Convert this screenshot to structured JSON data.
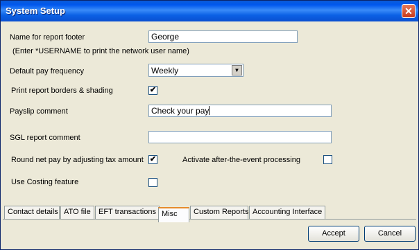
{
  "window": {
    "title": "System Setup"
  },
  "form": {
    "footer_label": "Name for report footer",
    "footer_value": "George",
    "footer_hint": "(Enter *USERNAME to print the network user name)",
    "pay_freq_label": "Default pay frequency",
    "pay_freq_value": "Weekly",
    "borders_label": "Print report borders & shading",
    "borders_checked": "✔",
    "payslip_label": "Payslip comment",
    "payslip_value": "Check your pay",
    "sgl_label": "SGL report comment",
    "sgl_value": "",
    "round_label": "Round net pay by adjusting tax amount",
    "round_checked": "✔",
    "after_event_label": "Activate after-the-event processing",
    "after_event_checked": "",
    "costing_label": "Use Costing feature",
    "costing_checked": ""
  },
  "tabs": [
    {
      "label": "Contact details"
    },
    {
      "label": "ATO file"
    },
    {
      "label": "EFT transactions"
    },
    {
      "label": "Misc"
    },
    {
      "label": "Custom Reports"
    },
    {
      "label": "Accounting Interface"
    }
  ],
  "buttons": {
    "accept": "Accept",
    "cancel": "Cancel"
  }
}
